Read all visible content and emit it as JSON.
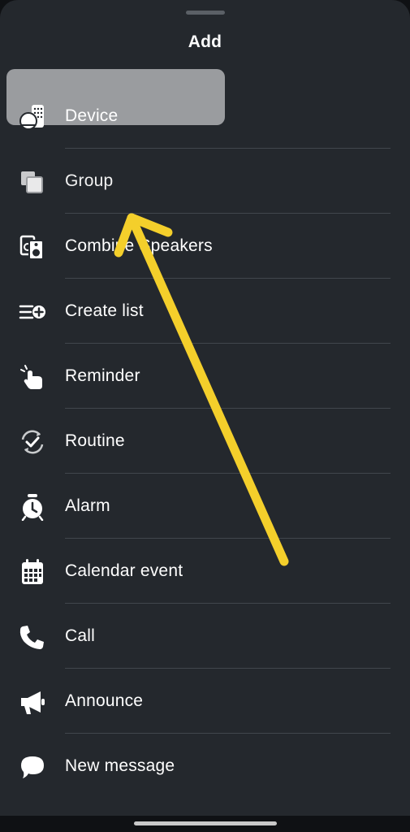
{
  "sheet": {
    "title": "Add"
  },
  "menu": {
    "items": [
      {
        "label": "Device",
        "icon": "device-icon"
      },
      {
        "label": "Group",
        "icon": "group-icon",
        "selected": true
      },
      {
        "label": "Combine Speakers",
        "icon": "speakers-icon"
      },
      {
        "label": "Create list",
        "icon": "create-list-icon"
      },
      {
        "label": "Reminder",
        "icon": "reminder-icon"
      },
      {
        "label": "Routine",
        "icon": "routine-icon"
      },
      {
        "label": "Alarm",
        "icon": "alarm-icon"
      },
      {
        "label": "Calendar event",
        "icon": "calendar-icon"
      },
      {
        "label": "Call",
        "icon": "phone-icon"
      },
      {
        "label": "Announce",
        "icon": "megaphone-icon"
      },
      {
        "label": "New message",
        "icon": "message-bubble-icon"
      }
    ]
  },
  "colors": {
    "sheet_background": "#24282d",
    "highlight": "#9a9c9f",
    "annotation_arrow": "#f4cf2b"
  }
}
